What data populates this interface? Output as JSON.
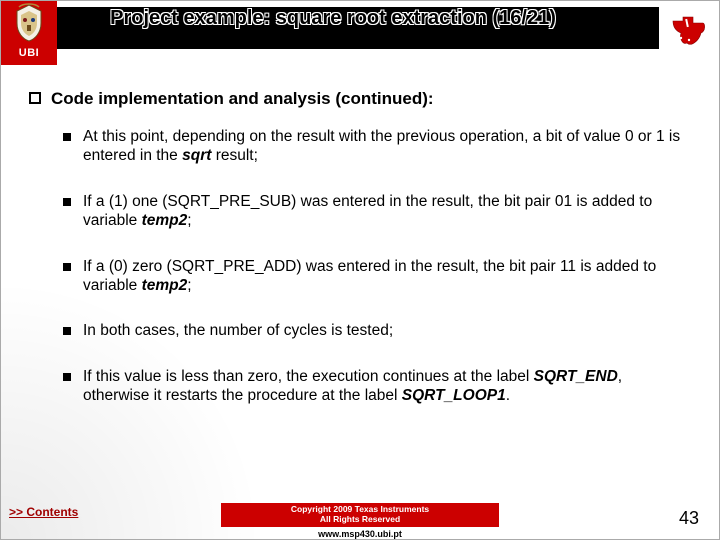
{
  "header": {
    "title": "Project example: square root extraction (16/21)",
    "ubi_label": "UBI"
  },
  "section": {
    "bullet_glyph": "q",
    "heading": "Code implementation and analysis (continued):"
  },
  "items": [
    {
      "pre": "At this point, depending on the result with the previous operation, a bit of value 0 or 1 is entered in the ",
      "em": "sqrt",
      "post": " result;"
    },
    {
      "pre": "If a (1) one (SQRT_PRE_SUB) was entered in the result, the bit pair 01 is added to variable ",
      "em": "temp2",
      "post": ";"
    },
    {
      "pre": "If a (0) zero (SQRT_PRE_ADD) was entered in the result, the bit pair 11 is added to variable ",
      "em": "temp2",
      "post": ";"
    },
    {
      "pre": "In both cases, the number of cycles is tested;",
      "em": "",
      "post": ""
    },
    {
      "pre": "If this value is less than zero, the execution continues at the label ",
      "em": "SQRT_END",
      "post": ", otherwise it restarts the procedure at the label ",
      "em2": "SQRT_LOOP1",
      "post2": "."
    }
  ],
  "footer": {
    "contents_link": ">> Contents",
    "copyright_line1": "Copyright 2009 Texas Instruments",
    "copyright_line2": "All Rights Reserved",
    "url": "www.msp430.ubi.pt",
    "slide_number": "43"
  }
}
